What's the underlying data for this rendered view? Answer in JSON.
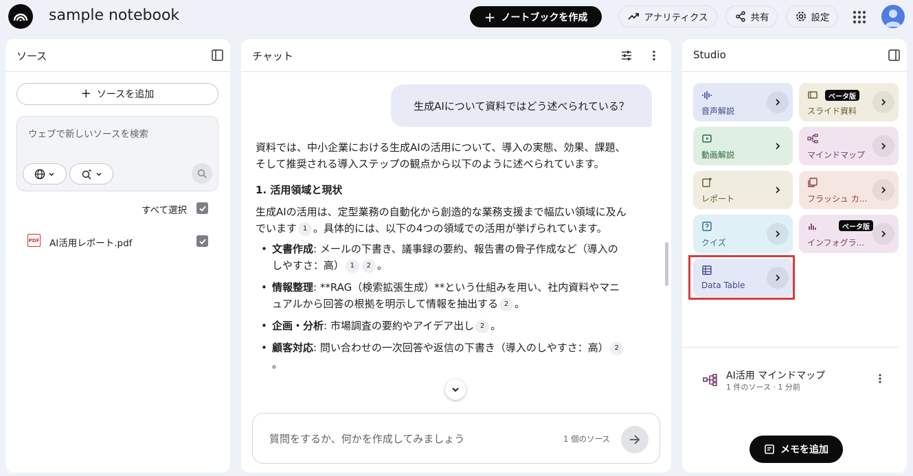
{
  "header": {
    "notebook_title": "sample notebook",
    "create_label": "ノートブックを作成",
    "analytics_label": "アナリティクス",
    "share_label": "共有",
    "settings_label": "設定"
  },
  "sources": {
    "title": "ソース",
    "add_label": "ソースを追加",
    "search_placeholder": "ウェブで新しいソースを検索",
    "select_all_label": "すべて選択",
    "items": [
      {
        "name": "AI活用レポート.pdf",
        "checked": true
      }
    ]
  },
  "chat": {
    "title": "チャット",
    "user_message": "生成AIについて資料ではどう述べられている？",
    "answer": {
      "intro": "資料では、中小企業における生成AIの活用について、導入の実態、効果、課題、そして推奨される導入ステップの観点から以下のように述べられています。",
      "heading": "1. 活用領域と現状",
      "para_a": "生成AIの活用は、定型業務の自動化から創造的な業務支援まで幅広い領域に及んでいます",
      "para_b": "。具体的には、以下の4つの領域での活用が挙げられています。",
      "items": [
        {
          "term": "文書作成",
          "text": ": メールの下書き、議事録の要約、報告書の骨子作成など（導入のしやすさ：高）",
          "cites": [
            "1",
            "2"
          ],
          "tail": "。"
        },
        {
          "term": "情報整理",
          "text": ": **RAG（検索拡張生成）**という仕組みを用い、社内資料やマニュアルから回答の根拠を明示して情報を抽出する",
          "cites": [
            "2"
          ],
          "tail": "。"
        },
        {
          "term": "企画・分析",
          "text": ": 市場調査の要約やアイデア出し",
          "cites": [
            "2"
          ],
          "tail": "。"
        },
        {
          "term": "顧客対応",
          "text": ": 問い合わせの一次回答や返信の下書き（導入のしやすさ：高）",
          "cites": [
            "2"
          ],
          "tail": "。"
        }
      ],
      "cite_intro": "1"
    },
    "input_placeholder": "質問をするか、何かを作成してみましょう",
    "source_count": "1 個のソース"
  },
  "studio": {
    "title": "Studio",
    "beta_label": "ベータ版",
    "tiles": [
      {
        "label": "音声解説",
        "bg": "#e3e7f6",
        "fg": "#3f4a8a",
        "icon": "audio-wave-icon"
      },
      {
        "label": "スライド資料",
        "bg": "#f0ede0",
        "fg": "#6b5b2b",
        "icon": "slides-icon"
      },
      {
        "label": "動画解説",
        "bg": "#e0efe4",
        "fg": "#2d6a3e",
        "icon": "video-icon"
      },
      {
        "label": "マインドマップ",
        "bg": "#f1e4ee",
        "fg": "#7a3a6c",
        "icon": "mindmap-icon"
      },
      {
        "label": "レポート",
        "bg": "#f0ede0",
        "fg": "#6b5b2b",
        "icon": "report-icon"
      },
      {
        "label": "フラッシュ カ...",
        "bg": "#f6e6e2",
        "fg": "#8a3f35",
        "icon": "flashcard-icon"
      },
      {
        "label": "クイズ",
        "bg": "#dff0f6",
        "fg": "#2a6a82",
        "icon": "quiz-icon"
      },
      {
        "label": "インフォグラ...",
        "bg": "#f1e4ee",
        "fg": "#7a3a6c",
        "icon": "infographic-icon"
      },
      {
        "label": "Data Table",
        "bg": "#e3e7f6",
        "fg": "#3f4a8a",
        "icon": "table-icon"
      }
    ],
    "note": {
      "title": "AI活用 マインドマップ",
      "subtitle": "1 件のソース · 1 分前"
    },
    "memo_label": "メモを追加"
  }
}
